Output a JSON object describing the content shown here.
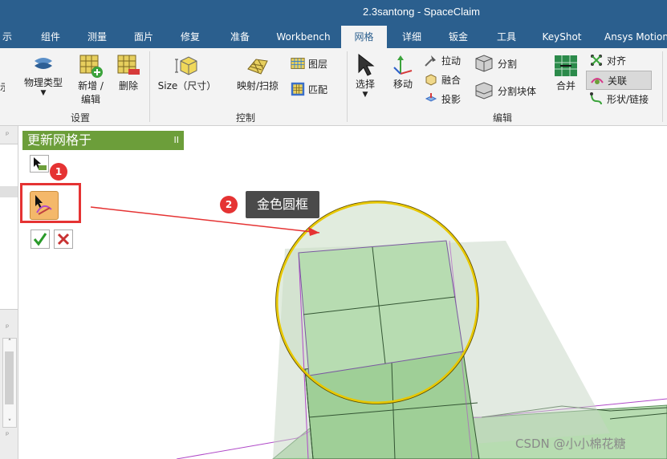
{
  "window": {
    "title": "2.3santong - SpaceClaim"
  },
  "tabs": [
    {
      "label": "显示",
      "partial": "示"
    },
    {
      "label": "组件"
    },
    {
      "label": "测量"
    },
    {
      "label": "面片"
    },
    {
      "label": "修复"
    },
    {
      "label": "准备"
    },
    {
      "label": "Workbench"
    },
    {
      "label": "网格",
      "active": true
    },
    {
      "label": "详细"
    },
    {
      "label": "钣金"
    },
    {
      "label": "工具"
    },
    {
      "label": "KeyShot"
    },
    {
      "label": "Ansys Motion"
    }
  ],
  "ribbon": {
    "setup": {
      "physics_type": "物理类型",
      "new_edit": "新增 /",
      "new_edit2": "编辑",
      "delete": "删除",
      "group_label": "设置"
    },
    "control": {
      "size": "Size（尺寸）",
      "map_sweep": "映射/扫掠",
      "layer": "图层",
      "match": "匹配",
      "group_label": "控制"
    },
    "edit": {
      "select": "选择",
      "move": "移动",
      "pull": "拉动",
      "fuse": "融合",
      "project": "投影",
      "split": "分割",
      "split_block": "分割块体",
      "merge": "合并",
      "align": "对齐",
      "associate": "关联",
      "shape_link": "形状/链接",
      "group_label": "编辑"
    }
  },
  "guide_panel": {
    "title": "更新网格于",
    "pause_glyph": "II"
  },
  "annotations": {
    "badge1": "1",
    "badge2": "2",
    "callout": "金色圆框"
  },
  "watermark": "CSDN @小小棉花糖",
  "colors": {
    "title_bar": "#2b5f8e",
    "ribbon_bg": "#f3f3f3",
    "guide_green": "#6c9e3a",
    "highlight_red": "#e53333",
    "gold_circle": "#e8c800",
    "mesh_green": "#b7dcb1"
  }
}
